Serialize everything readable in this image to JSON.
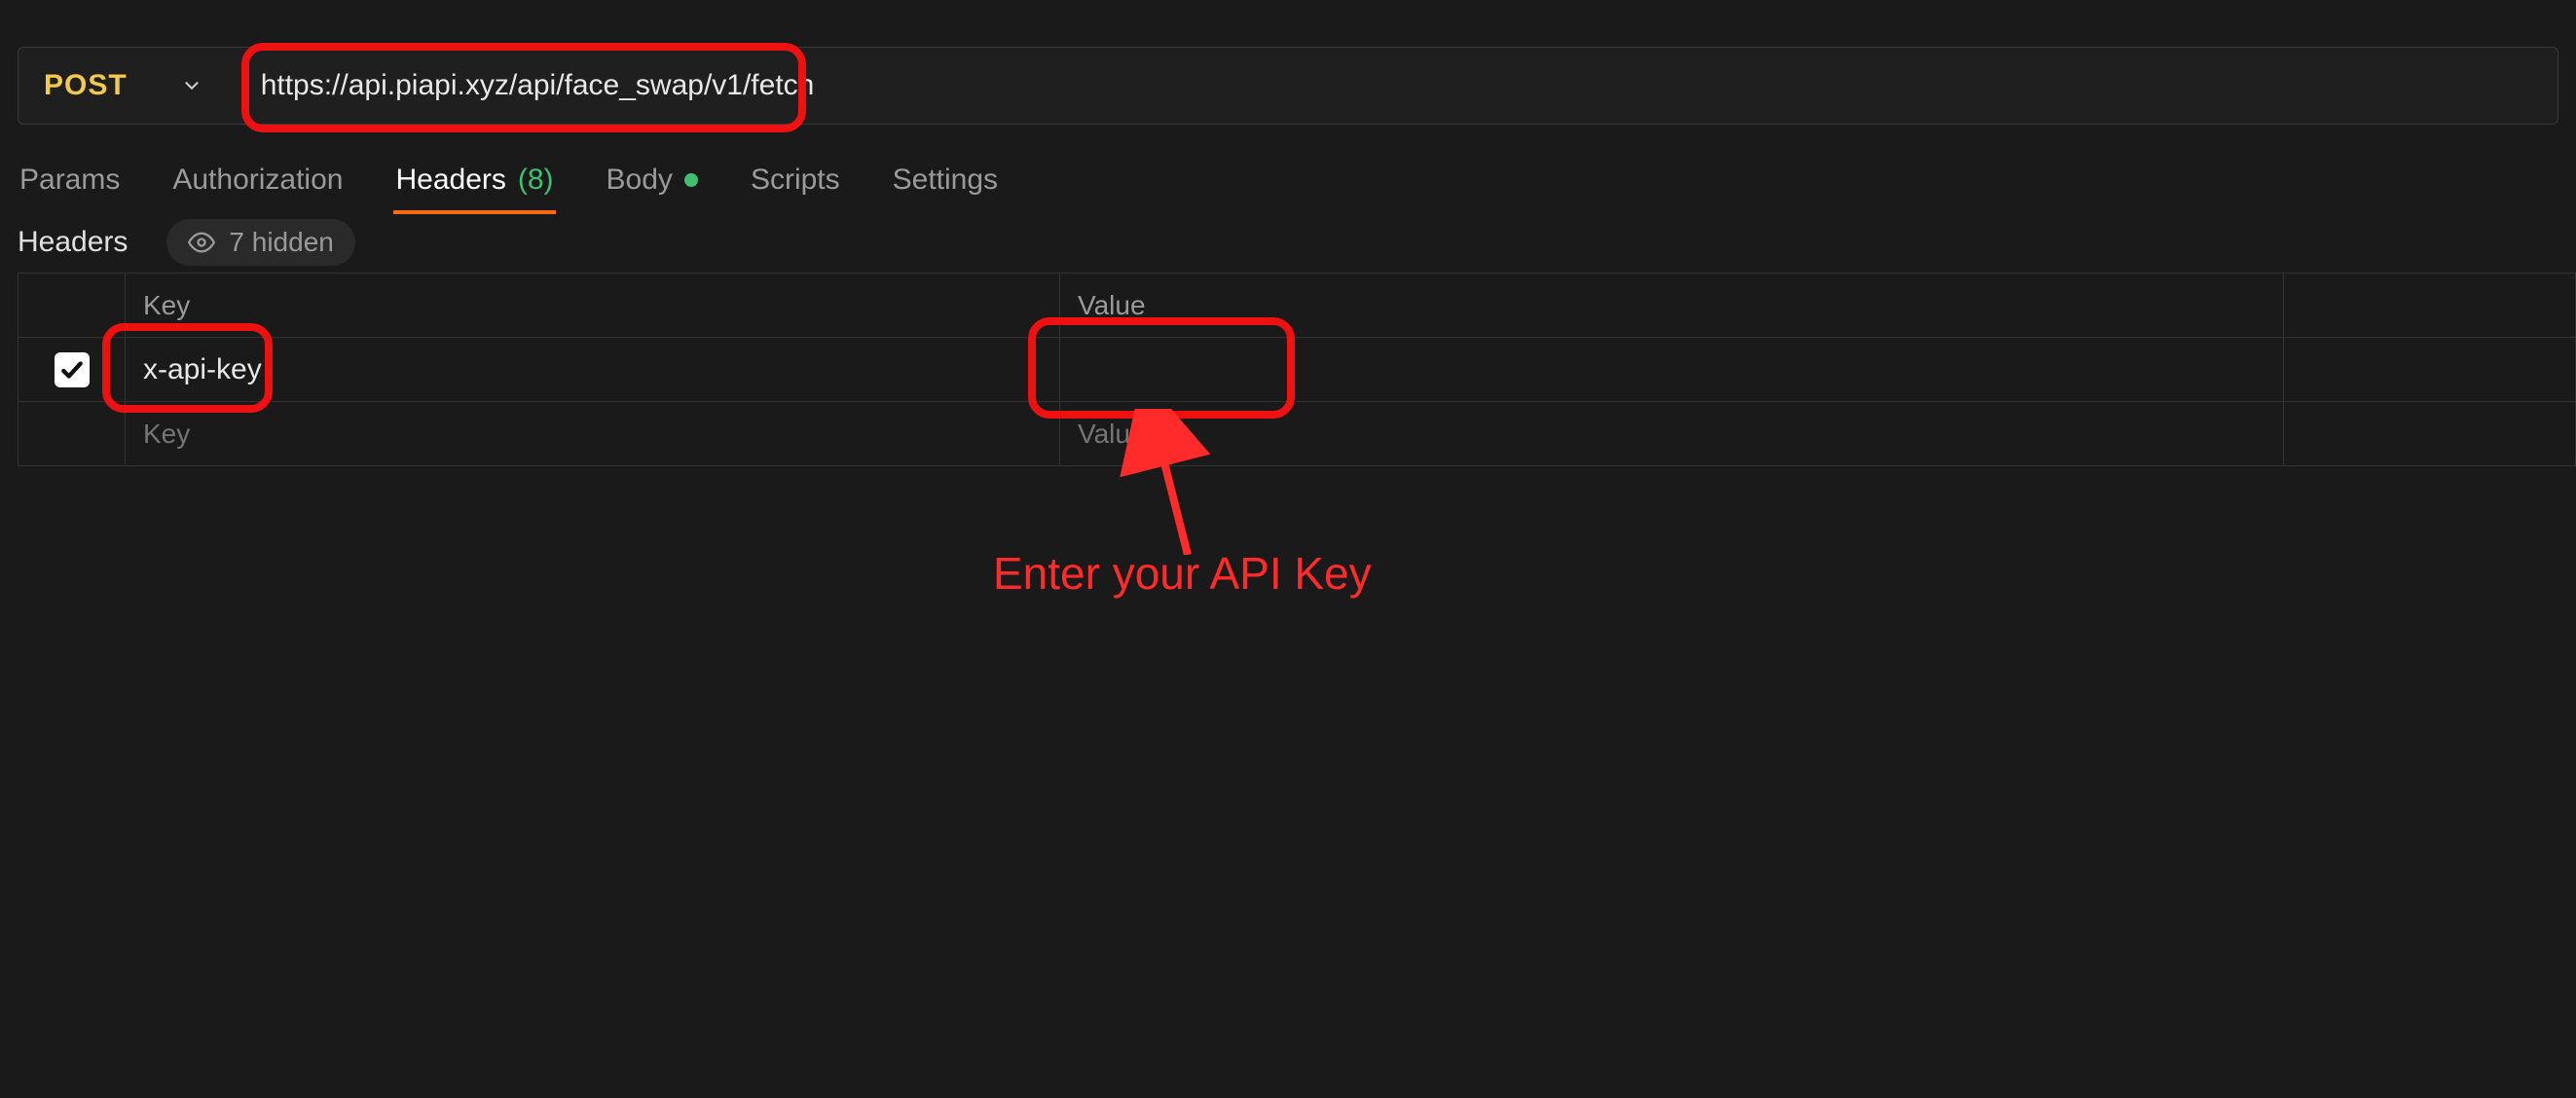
{
  "request": {
    "method": "POST",
    "url": "https://api.piapi.xyz/api/face_swap/v1/fetch"
  },
  "tabs": {
    "params": "Params",
    "authorization": "Authorization",
    "headers": "Headers",
    "headers_count": "(8)",
    "body": "Body",
    "scripts": "Scripts",
    "settings": "Settings"
  },
  "section": {
    "title": "Headers",
    "hidden_label": "7 hidden"
  },
  "table": {
    "header_key": "Key",
    "header_value": "Value",
    "rows": [
      {
        "checked": true,
        "key": "x-api-key",
        "value": ""
      }
    ],
    "placeholder_key": "Key",
    "placeholder_value": "Value"
  },
  "annotation": {
    "text": "Enter your API Key"
  }
}
